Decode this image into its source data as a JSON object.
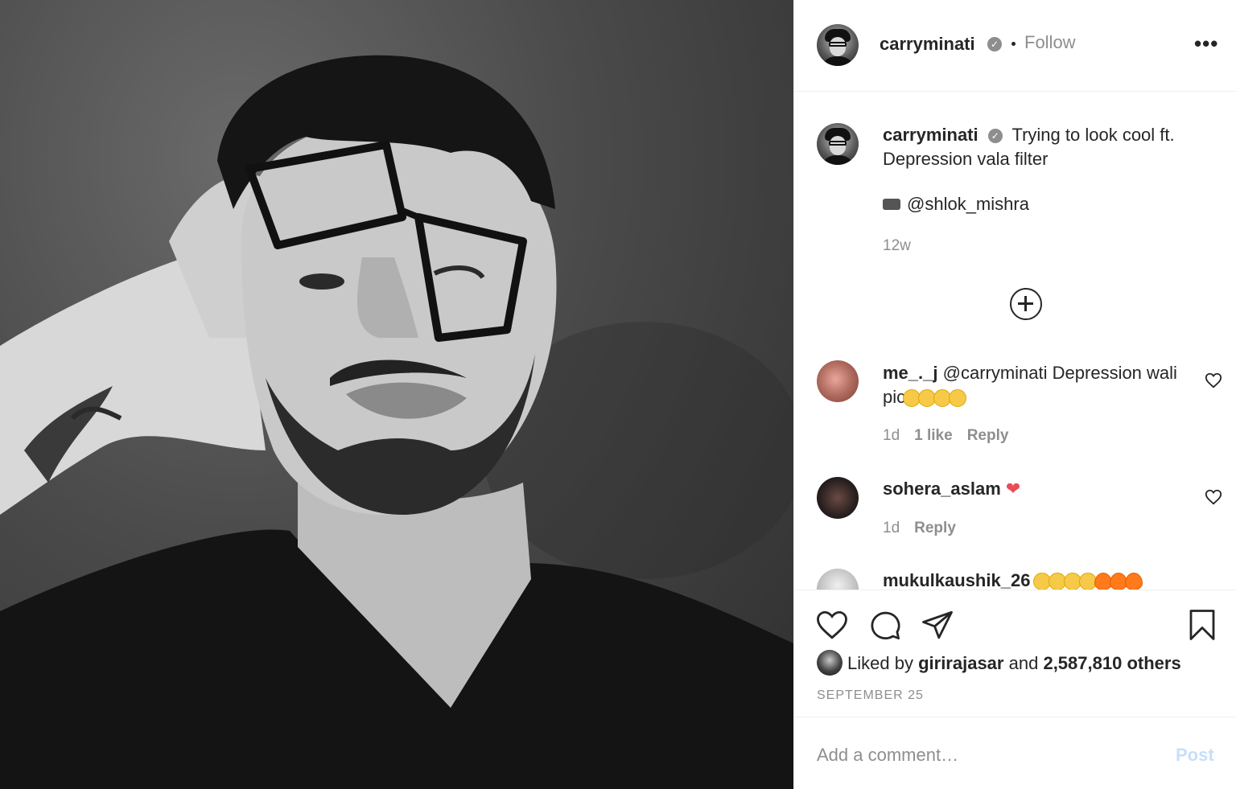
{
  "post": {
    "image_alt": "Black and white photo of a man wearing oversized glasses with hand on head"
  },
  "header": {
    "username": "carryminati",
    "follow_label": "Follow",
    "more_label": "•••"
  },
  "caption": {
    "username": "carryminati",
    "text_line1": "Trying to look cool ft.",
    "text_line2": "Depression vala filter",
    "credit": "@shlok_mishra",
    "time": "12w"
  },
  "comments": [
    {
      "username": "me_._j",
      "text": "@carryminati Depression wali pic",
      "time": "1d",
      "likes": "1 like",
      "reply": "Reply"
    },
    {
      "username": "sohera_aslam",
      "text": "",
      "time": "1d",
      "reply": "Reply"
    },
    {
      "username": "mukulkaushik_26",
      "text": ""
    }
  ],
  "actions": {
    "liked_prefix": "Liked by",
    "liked_user": "girirajasar",
    "liked_and": "and",
    "liked_others": "2,587,810 others",
    "date": "SEPTEMBER 25"
  },
  "add_comment": {
    "placeholder": "Add a comment…",
    "post_label": "Post"
  },
  "colors": {
    "accent": "#0095f6",
    "post_disabled": "#c6dffa",
    "heart_red": "#ed4956",
    "muted": "#8e8e8e",
    "text": "#262626"
  }
}
